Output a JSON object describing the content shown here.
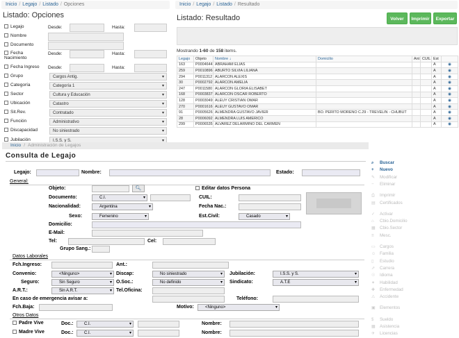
{
  "left_panel": {
    "breadcrumb": [
      "Inicio",
      "Legajo",
      "Listado",
      "Opciones"
    ],
    "title": "Listado: Opciones",
    "rows": [
      {
        "label": "Legajo",
        "from": "Desde:",
        "to": "Hasta:"
      },
      {
        "label": "Nombre"
      },
      {
        "label": "Documento"
      },
      {
        "label": "Fecha Nacimiento",
        "from": "Desde:",
        "to": "Hasta:"
      },
      {
        "label": "Fecha Ingreso",
        "from": "Desde:",
        "to": "Hasta:"
      },
      {
        "label": "Grupo",
        "value": "Cargos Antig."
      },
      {
        "label": "Categoría",
        "value": "Categoría 1"
      },
      {
        "label": "Sector",
        "value": "Cultura y Educación"
      },
      {
        "label": "Ubicación",
        "value": "Catastro"
      },
      {
        "label": "Sit.Rev.",
        "value": "Contratado"
      },
      {
        "label": "Función",
        "value": "Administrativo"
      },
      {
        "label": "Discapacidad",
        "value": "No siniestrado"
      },
      {
        "label": "Jubilación",
        "value": "I.S.S. y S."
      }
    ]
  },
  "right_panel": {
    "breadcrumb": [
      "Inicio",
      "Legajo",
      "Listado",
      "Resultado"
    ],
    "title": "Listado: Resultado",
    "buttons": {
      "back": "Volver",
      "print": "Imprimir",
      "export": "Exportar"
    },
    "summary": {
      "prefix": "Mostrando ",
      "range": "1-60",
      "middle": " de ",
      "total": "158",
      "suffix": " items."
    },
    "columns": [
      "Legajo",
      "Objeto",
      "Nombre",
      "Domicilio",
      "Ant",
      "CUIL",
      "Est"
    ],
    "rows": [
      {
        "legajo": "163",
        "objeto": "P0004644",
        "nombre": "ABRAHAM ELIAS",
        "domicilio": "",
        "est": "A"
      },
      {
        "legajo": "259",
        "objeto": "P0010896",
        "nombre": "ABURTO SILVIA LILIANA",
        "domicilio": "",
        "est": "A"
      },
      {
        "legajo": "294",
        "objeto": "P0011312",
        "nombre": "ALARCON ALEXIS",
        "domicilio": "",
        "est": "A"
      },
      {
        "legajo": "30",
        "objeto": "P0002792",
        "nombre": "ALARCON AMELIA",
        "domicilio": "",
        "est": "A"
      },
      {
        "legajo": "247",
        "objeto": "P0011580",
        "nombre": "ALARCON GLORIA ELISABET",
        "domicilio": "",
        "est": "A"
      },
      {
        "legajo": "168",
        "objeto": "P0003837",
        "nombre": "ALARCON OSCAR ROBERTO",
        "domicilio": "",
        "est": "A"
      },
      {
        "legajo": "128",
        "objeto": "P0003049",
        "nombre": "ALEUY CRISTIAN OMAR",
        "domicilio": "",
        "est": "A"
      },
      {
        "legajo": "270",
        "objeto": "P0001616",
        "nombre": "ALEUY GUSTAVO OMAR",
        "domicilio": "",
        "est": "A"
      },
      {
        "legajo": "91",
        "objeto": "P0005626",
        "nombre": "ALMENDRA GUSTAVO JAVIER",
        "domicilio": "BO. PERITO MORENO C.29 - TREVELIN - CHUBUT",
        "est": "A"
      },
      {
        "legajo": "28",
        "objeto": "P0006092",
        "nombre": "ALMENDRA LUIS AMERICO",
        "domicilio": "",
        "est": "A"
      },
      {
        "legajo": "299",
        "objeto": "P0006535",
        "nombre": "ALVAREZ DELARMINO DEL CARMEN",
        "domicilio": "",
        "est": "A"
      }
    ]
  },
  "bottom": {
    "breadcrumb": [
      "Inicio",
      "Administración de Legajos"
    ],
    "title": "Consulta de Legajo",
    "labels": {
      "legajo": "Legajo:",
      "nombre": "Nombre:",
      "estado": "Estado:",
      "general": "General:",
      "objeto": "Objeto:",
      "editar": "Editar datos Persona",
      "documento": "Documento:",
      "cuil": "CUIL:",
      "nacionalidad": "Nacionalidad:",
      "fechnac": "Fecha Nac.:",
      "sexo": "Sexo:",
      "estcivil": "Est.Civil:",
      "domicilio": "Domicilio:",
      "email": "E-Mail:",
      "tel": "Tel:",
      "cel": "Cel:",
      "gruposang": "Grupo Sang.:",
      "datos_laborales": "Datos Laborales",
      "fchingreso": "Fch.Ingreso:",
      "ant": "Ant.:",
      "convenio": "Convenio:",
      "discap": "Discap:",
      "jubilacion": "Jubilación:",
      "seguro": "Seguro:",
      "osoc": "O.Soc.:",
      "sindicato": "Sindicato:",
      "art": "A.R.T.:",
      "teloficina": "Tel.Oficina:",
      "emergencia": "En caso de emergencia avisar a:",
      "telefono": "Teléfono:",
      "fchbaja": "Fch.Baja:",
      "motivo": "Motivo:",
      "otros_datos": "Otros Datos",
      "padre": "Padre Vive",
      "madre": "Madre Vive",
      "doc": "Doc.:",
      "nombre2": "Nombre:"
    },
    "values": {
      "documento": "C.I.",
      "nacionalidad": "Argentina",
      "sexo": "Femenino",
      "estcivil": "Casado",
      "convenio": "<Ninguno>",
      "discap": "No siniestrado",
      "jubilacion": "I.S.S. y S.",
      "seguro": "Sin Seguro",
      "osoc": "No definido",
      "sindicato": "A.T.E",
      "art": "Sin A.R.T.",
      "motivo": "<Ninguno>",
      "padre_doc": "C.I.",
      "madre_doc": "C.I."
    },
    "side_menu": [
      {
        "label": "Buscar",
        "icon": "search-icon",
        "active": true
      },
      {
        "label": "Nuevo",
        "icon": "plus-icon",
        "active": true
      },
      {
        "label": "Modificar",
        "icon": "pencil-icon",
        "active": false
      },
      {
        "label": "Eliminar",
        "icon": "minus-icon",
        "active": false
      },
      {
        "label": "Imprimir",
        "icon": "print-icon",
        "active": false
      },
      {
        "label": "Certificados",
        "icon": "certificate-icon",
        "active": false
      },
      {
        "label": "Activar",
        "icon": "check-icon",
        "active": false
      },
      {
        "label": "Cbio.Domicilio",
        "icon": "home-icon",
        "active": false
      },
      {
        "label": "Cbio.Sector",
        "icon": "sector-icon",
        "active": false
      },
      {
        "label": "Mesc.",
        "icon": "misc-icon",
        "active": false
      },
      {
        "label": "Cargos",
        "icon": "briefcase-icon",
        "active": false
      },
      {
        "label": "Familia",
        "icon": "family-icon",
        "active": false
      },
      {
        "label": "Estudio",
        "icon": "book-icon",
        "active": false
      },
      {
        "label": "Carrera",
        "icon": "career-icon",
        "active": false
      },
      {
        "label": "Idioma",
        "icon": "language-icon",
        "active": false
      },
      {
        "label": "Habilidad",
        "icon": "skill-icon",
        "active": false
      },
      {
        "label": "Enfermedad",
        "icon": "medical-icon",
        "active": false
      },
      {
        "label": "Accidente",
        "icon": "warning-icon",
        "active": false
      },
      {
        "label": "Elementos",
        "icon": "box-icon",
        "active": false
      },
      {
        "label": "Sueldo",
        "icon": "money-icon",
        "active": false
      },
      {
        "label": "Asistencia",
        "icon": "calendar-icon",
        "active": false
      },
      {
        "label": "Licencias",
        "icon": "leave-icon",
        "active": false
      }
    ]
  }
}
